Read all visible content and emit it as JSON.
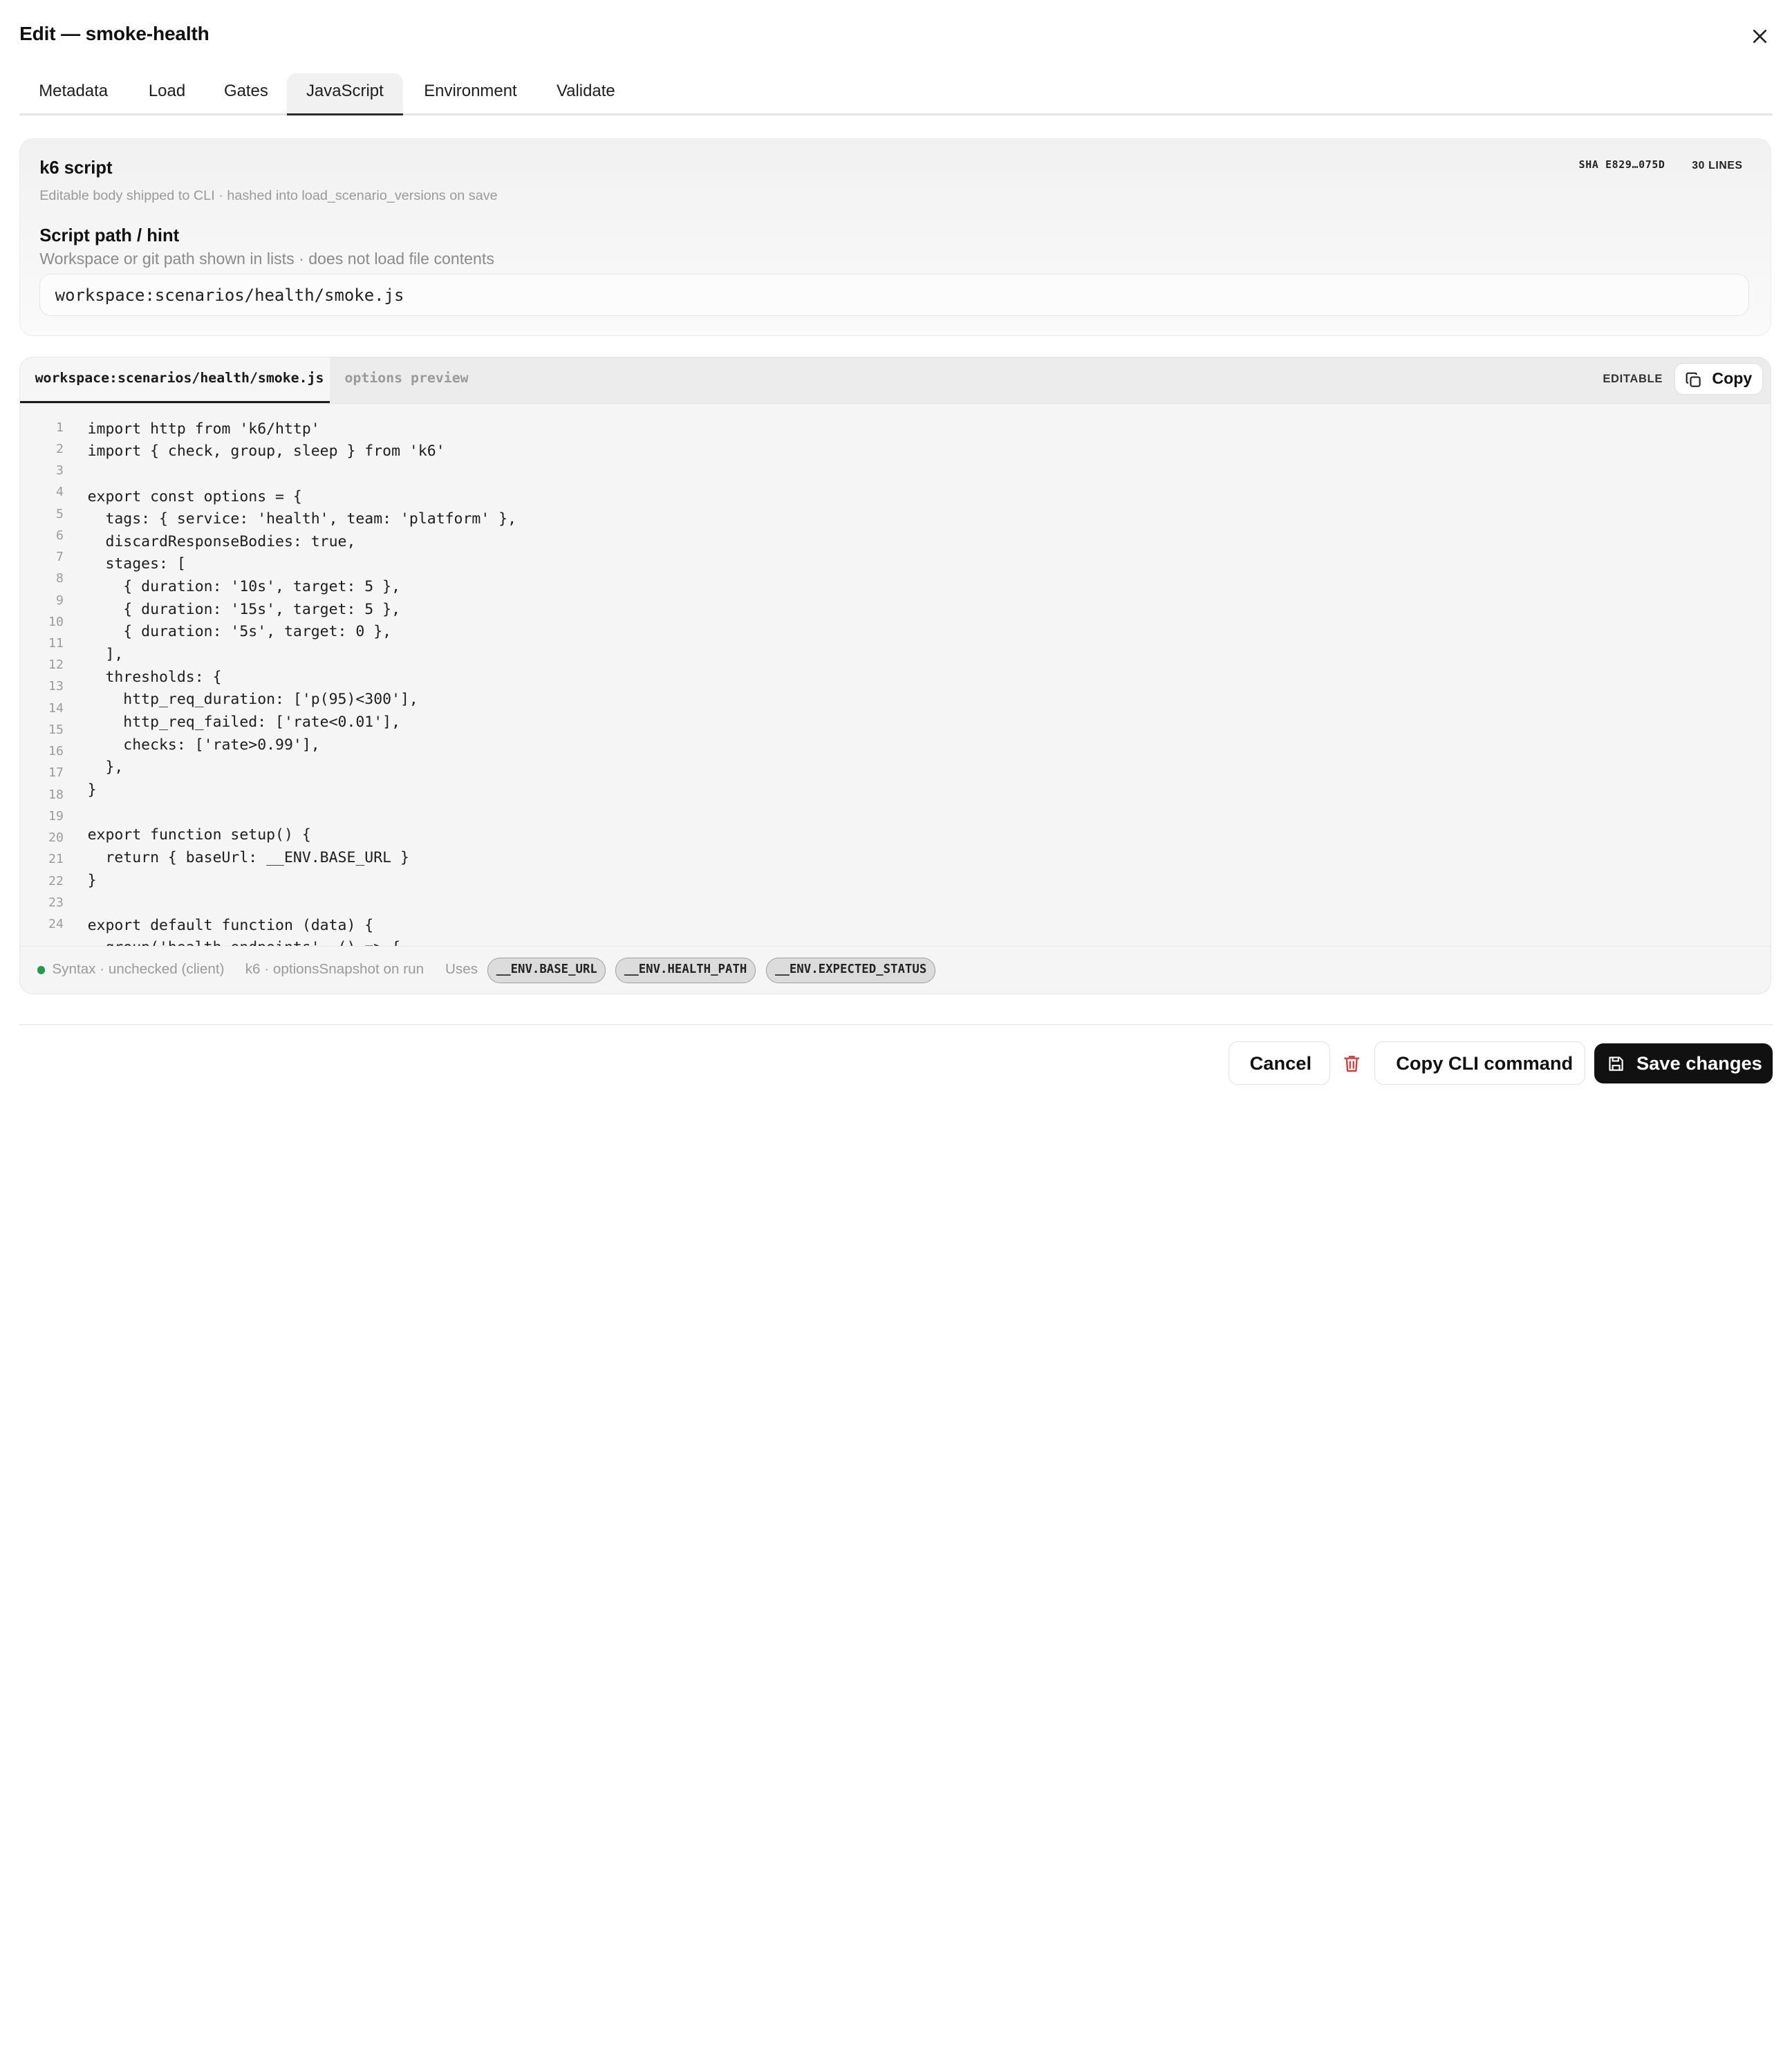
{
  "dialog": {
    "title": "Edit — smoke-health",
    "tabs": [
      "Metadata",
      "Load",
      "Gates",
      "JavaScript",
      "Environment",
      "Validate"
    ],
    "active_tab": "JavaScript"
  },
  "script_card": {
    "title": "k6 script",
    "subtitle": "Editable body shipped to CLI · hashed into load_scenario_versions on save",
    "sha_badge": "SHA E829…075D",
    "lines_badge": "30 LINES",
    "path_label": "Script path / hint",
    "path_help": "Workspace or git path shown in lists · does not load file contents",
    "path_value": "workspace:scenarios/health/smoke.js"
  },
  "editor": {
    "file_tab": "workspace:scenarios/health/smoke.js",
    "preview_tab": "options preview",
    "editable_badge": "EDITABLE",
    "copy_label": "Copy",
    "lines": [
      "import http from 'k6/http'",
      "import { check, group, sleep } from 'k6'",
      "",
      "export const options = {",
      "  tags: { service: 'health', team: 'platform' },",
      "  discardResponseBodies: true,",
      "  stages: [",
      "    { duration: '10s', target: 5 },",
      "    { duration: '15s', target: 5 },",
      "    { duration: '5s', target: 0 },",
      "  ],",
      "  thresholds: {",
      "    http_req_duration: ['p(95)<300'],",
      "    http_req_failed: ['rate<0.01'],",
      "    checks: ['rate>0.99'],",
      "  },",
      "}",
      "",
      "export function setup() {",
      "  return { baseUrl: __ENV.BASE_URL }",
      "}",
      "",
      "export default function (data) {",
      "  group('health endpoints', () => {"
    ],
    "footer": {
      "syntax_status": "Syntax · unchecked (client)",
      "snapshot_note": "k6 · optionsSnapshot on run",
      "uses_label": "Uses",
      "env_vars": [
        "__ENV.BASE_URL",
        "__ENV.HEALTH_PATH",
        "__ENV.EXPECTED_STATUS"
      ],
      "status_color": "#1f9d4c"
    }
  },
  "actions": {
    "cancel": "Cancel",
    "copy_cli": "Copy CLI command",
    "save": "Save changes",
    "delete_color": "#d43a3a"
  }
}
